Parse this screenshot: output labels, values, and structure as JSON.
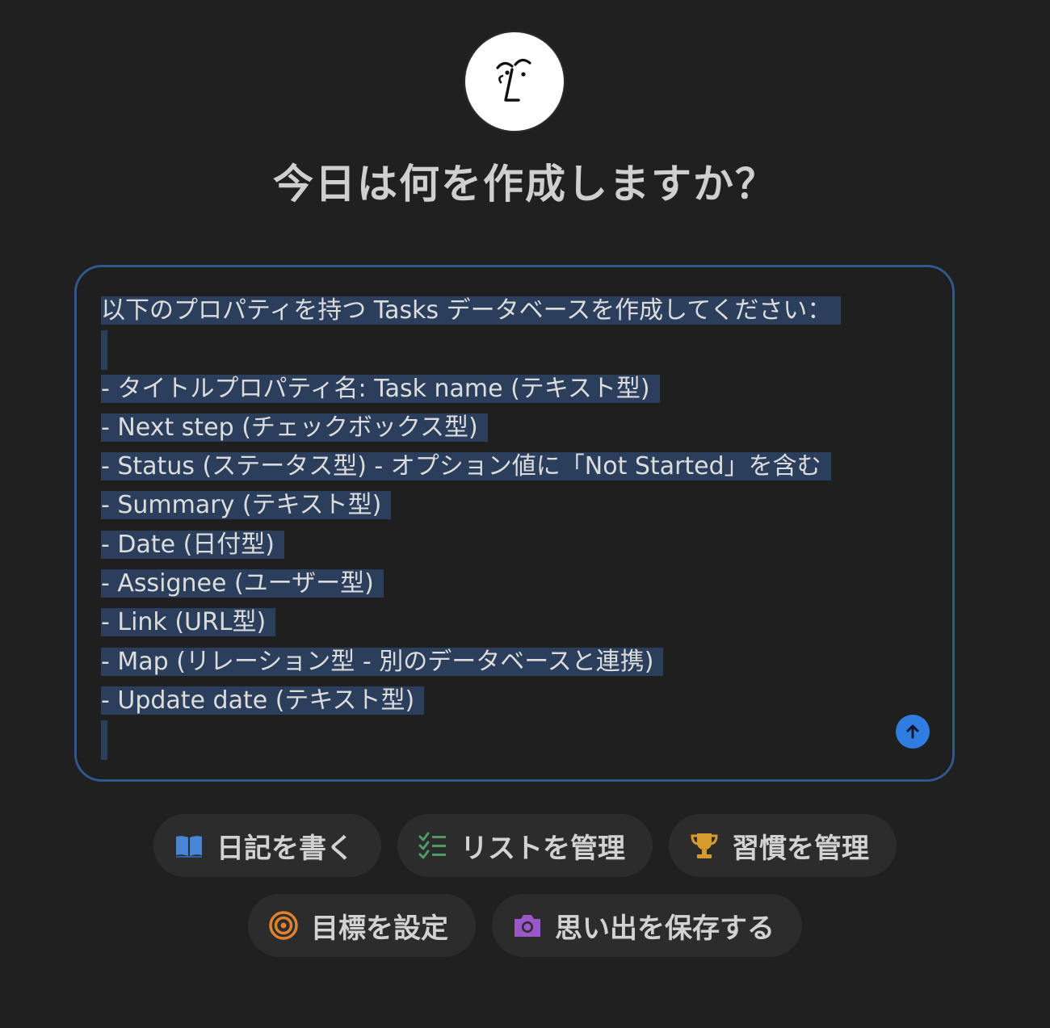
{
  "page": {
    "title": "今日は何を作成しますか？"
  },
  "prompt": {
    "lines": [
      "以下のプロパティを持つ Tasks データベースを作成してください：",
      "",
      "- タイトルプロパティ名: Task name (テキスト型)",
      "- Next step (チェックボックス型)",
      "- Status (ステータス型) - オプション値に「Not Started」を含む",
      "- Summary (テキスト型)",
      "- Date (日付型)",
      "- Assignee (ユーザー型)",
      "- Link (URL型)",
      "- Map (リレーション型 - 別のデータベースと連携)",
      "- Update date (テキスト型)",
      ""
    ]
  },
  "suggestions": {
    "row1": [
      {
        "label": "日記を書く",
        "icon": "book-icon",
        "color": "#4a86d8"
      },
      {
        "label": "リストを管理",
        "icon": "checklist-icon",
        "color": "#4e9a68"
      },
      {
        "label": "習慣を管理",
        "icon": "trophy-icon",
        "color": "#d79a2c"
      }
    ],
    "row2": [
      {
        "label": "目標を設定",
        "icon": "target-icon",
        "color": "#e0812f"
      },
      {
        "label": "思い出を保存する",
        "icon": "camera-icon",
        "color": "#9a57c8"
      }
    ]
  },
  "colors": {
    "background": "#202020",
    "accent": "#2f7de1",
    "border": "#34578a",
    "selection": "#2b3e5b"
  }
}
